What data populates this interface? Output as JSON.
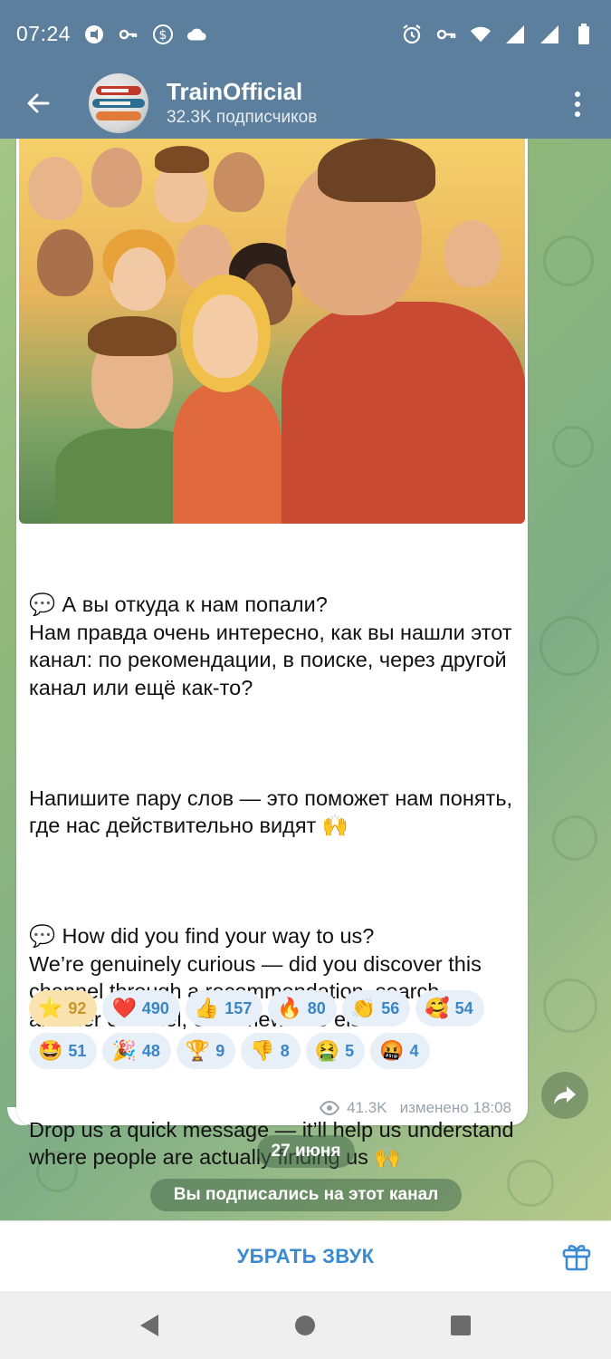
{
  "status_bar": {
    "time": "07:24"
  },
  "header": {
    "channel_name": "TrainOfficial",
    "subscribers": "32.3K подписчиков"
  },
  "post": {
    "paragraphs": [
      {
        "emoji": "💬",
        "text": "А вы откуда к нам попали?\nНам правда очень интересно, как вы нашли этот канал: по рекомендации, в поиске, через другой канал или ещё как-то?"
      },
      {
        "emoji": "",
        "text": "Напишите пару слов — это поможет нам понять, где нас действительно видят 🙌"
      },
      {
        "emoji": "💬",
        "text": "How did you find your way to us?\nWe’re genuinely curious — did you discover this channel through a recommendation, search, another channel, or somewhere else?"
      },
      {
        "emoji": "",
        "text": "Drop us a quick message — it’ll help us understand where people are actually finding us 🙌"
      }
    ],
    "reactions": [
      {
        "emoji": "⭐",
        "count": "92",
        "active": true
      },
      {
        "emoji": "❤️",
        "count": "490"
      },
      {
        "emoji": "👍",
        "count": "157"
      },
      {
        "emoji": "🔥",
        "count": "80"
      },
      {
        "emoji": "👏",
        "count": "56"
      },
      {
        "emoji": "🥰",
        "count": "54"
      },
      {
        "emoji": "🤩",
        "count": "51"
      },
      {
        "emoji": "🎉",
        "count": "48"
      },
      {
        "emoji": "🏆",
        "count": "9"
      },
      {
        "emoji": "👎",
        "count": "8"
      },
      {
        "emoji": "🤮",
        "count": "5"
      },
      {
        "emoji": "🤬",
        "count": "4"
      }
    ],
    "views": "41.3K",
    "edited": "изменено 18:08"
  },
  "date_divider": "27 июня",
  "service_message": "Вы подписались на этот канал",
  "action_bar": {
    "mute_label": "УБРАТЬ ЗВУК"
  },
  "colors": {
    "header_bg": "#5b7f9c",
    "accent": "#3a8ad1",
    "reaction_bg": "#e7f0f8",
    "active_reaction_bg": "#fbe3b0"
  }
}
